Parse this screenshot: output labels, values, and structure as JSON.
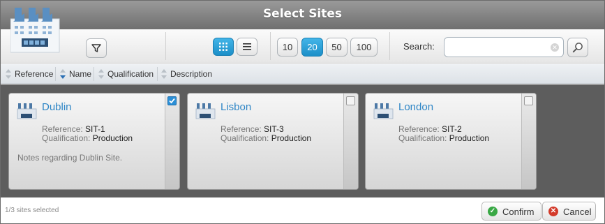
{
  "dialog": {
    "title": "Select Sites"
  },
  "toolbar": {
    "filter_icon": "filter-icon",
    "view_modes": [
      {
        "name": "grid-view",
        "icon": "grid-icon",
        "active": true
      },
      {
        "name": "list-view",
        "icon": "list-icon",
        "active": false
      }
    ],
    "page_sizes": [
      "10",
      "20",
      "50",
      "100"
    ],
    "active_page_size": "20",
    "search": {
      "label": "Search:",
      "value": "",
      "placeholder": ""
    }
  },
  "sort_columns": [
    {
      "label": "Reference",
      "sorted": false
    },
    {
      "label": "Name",
      "sorted": "desc"
    },
    {
      "label": "Qualification",
      "sorted": false
    },
    {
      "label": "Description",
      "sorted": false
    }
  ],
  "cards": [
    {
      "name": "Dublin",
      "reference_label": "Reference:",
      "reference": "SIT-1",
      "qualification_label": "Qualification:",
      "qualification": "Production",
      "notes": "Notes regarding Dublin Site.",
      "checked": true
    },
    {
      "name": "Lisbon",
      "reference_label": "Reference:",
      "reference": "SIT-3",
      "qualification_label": "Qualification:",
      "qualification": "Production",
      "notes": "",
      "checked": false
    },
    {
      "name": "London",
      "reference_label": "Reference:",
      "reference": "SIT-2",
      "qualification_label": "Qualification:",
      "qualification": "Production",
      "notes": "",
      "checked": false
    }
  ],
  "footer": {
    "status": "1/3 sites selected",
    "confirm_label": "Confirm",
    "cancel_label": "Cancel"
  },
  "colors": {
    "accent": "#2b8fd6",
    "card_title": "#2f86c6",
    "confirm_icon": "#39a845",
    "cancel_icon": "#d33a2a"
  }
}
